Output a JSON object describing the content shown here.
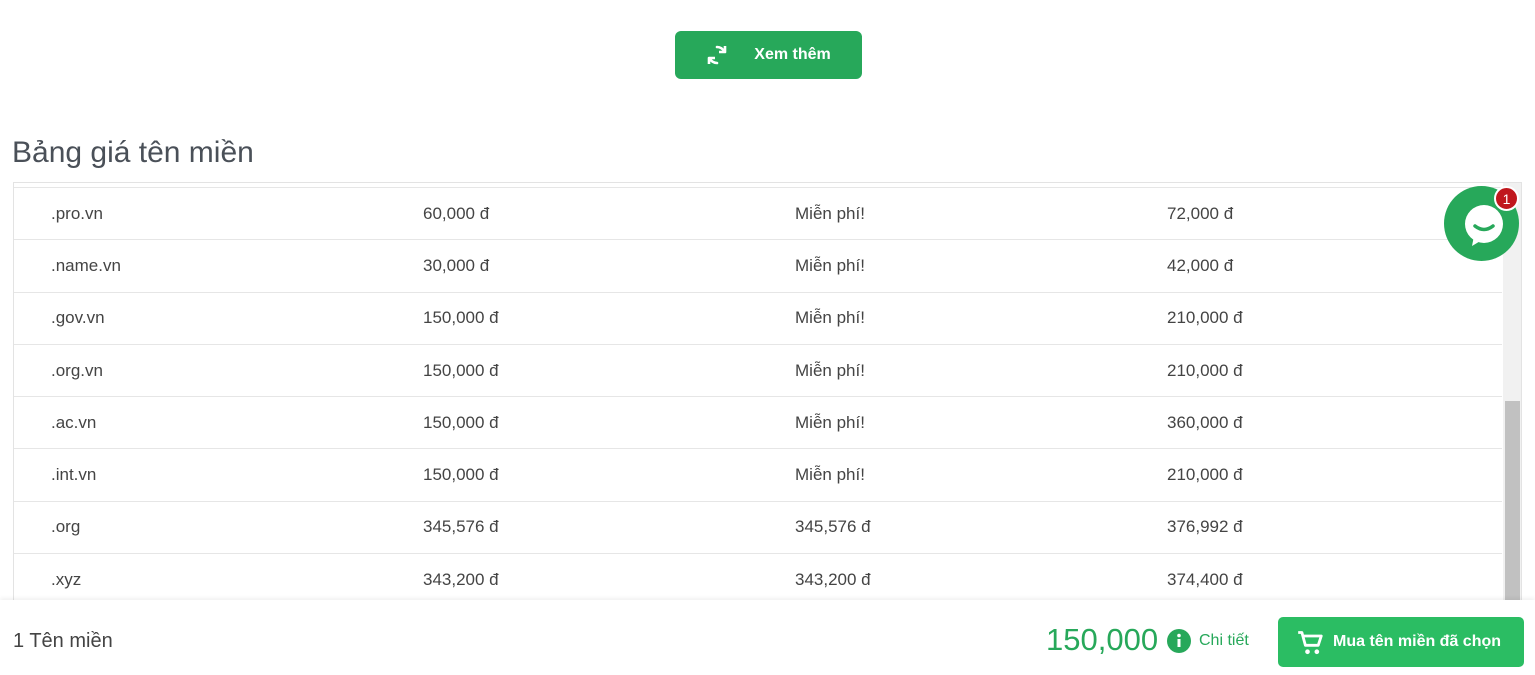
{
  "more_button": {
    "label": "Xem thêm"
  },
  "section_title": "Bảng giá tên miền",
  "price_table": {
    "rows": [
      {
        "tld": ".pro.vn",
        "price": "60,000 đ",
        "transfer": "Miễn phí!",
        "renew": "72,000 đ"
      },
      {
        "tld": ".name.vn",
        "price": "30,000 đ",
        "transfer": "Miễn phí!",
        "renew": "42,000 đ"
      },
      {
        "tld": ".gov.vn",
        "price": "150,000 đ",
        "transfer": "Miễn phí!",
        "renew": "210,000 đ"
      },
      {
        "tld": ".org.vn",
        "price": "150,000 đ",
        "transfer": "Miễn phí!",
        "renew": "210,000 đ"
      },
      {
        "tld": ".ac.vn",
        "price": "150,000 đ",
        "transfer": "Miễn phí!",
        "renew": "360,000 đ"
      },
      {
        "tld": ".int.vn",
        "price": "150,000 đ",
        "transfer": "Miễn phí!",
        "renew": "210,000 đ"
      },
      {
        "tld": ".org",
        "price": "345,576 đ",
        "transfer": "345,576 đ",
        "renew": "376,992 đ"
      },
      {
        "tld": ".xyz",
        "price": "343,200 đ",
        "transfer": "343,200 đ",
        "renew": "374,400 đ"
      }
    ]
  },
  "chat": {
    "badge_count": "1",
    "icon": "chat-icon"
  },
  "footer": {
    "count_label": "1 Tên miền",
    "total": "150,000",
    "detail_label": "Chi tiết",
    "buy_label": "Mua tên miền đã chọn"
  },
  "colors": {
    "accent": "#27a85a",
    "buy_button": "#2bbd63",
    "badge": "#c0171d"
  }
}
